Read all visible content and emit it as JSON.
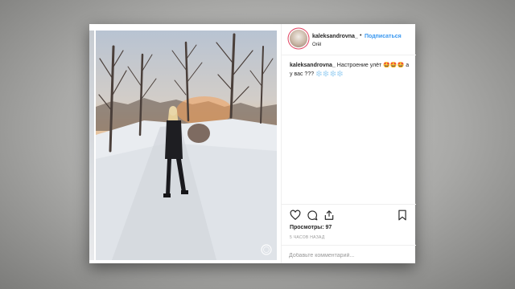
{
  "post": {
    "username": "kaleksandrovna_",
    "separator": "•",
    "follow_label": "Подписаться",
    "location": "Orël",
    "caption_user": "kaleksandrovna_",
    "caption_text": "Настроение улёт 🤩🤩🤩 а у вас ??? ❄️❄️❄️❄️",
    "views_label": "Просмотры: 97",
    "time_label": "5 ЧАСОВ НАЗАД",
    "comment_placeholder": "Добавьте комментарий..."
  },
  "icons": {
    "like": "heart-icon",
    "comment": "comment-icon",
    "share": "share-icon",
    "save": "bookmark-icon",
    "video": "video-indicator-icon"
  },
  "colors": {
    "link_blue": "#3897f0",
    "text": "#262626",
    "muted": "#999999"
  }
}
